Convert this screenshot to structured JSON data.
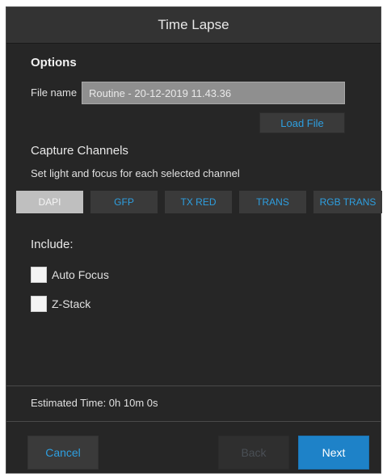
{
  "window": {
    "title": "Time Lapse"
  },
  "options": {
    "heading": "Options",
    "file_name_label": "File name",
    "file_name_value": "Routine - 20-12-2019 11.43.36",
    "load_file_label": "Load File"
  },
  "capture": {
    "heading": "Capture Channels",
    "subtitle": "Set light and focus for each selected channel",
    "channels": [
      {
        "label": "DAPI",
        "selected": true
      },
      {
        "label": "GFP",
        "selected": false
      },
      {
        "label": "TX RED",
        "selected": false
      },
      {
        "label": "TRANS",
        "selected": false
      },
      {
        "label": "RGB TRANS",
        "selected": false
      }
    ]
  },
  "include": {
    "heading": "Include:",
    "options": [
      {
        "label": "Auto Focus",
        "checked": false
      },
      {
        "label": "Z-Stack",
        "checked": false
      }
    ]
  },
  "footer": {
    "estimated_time": "Estimated Time: 0h 10m 0s",
    "cancel_label": "Cancel",
    "back_label": "Back",
    "next_label": "Next"
  },
  "colors": {
    "accent": "#2e9fe0",
    "primary_button": "#1e82c8",
    "background": "#262626"
  }
}
